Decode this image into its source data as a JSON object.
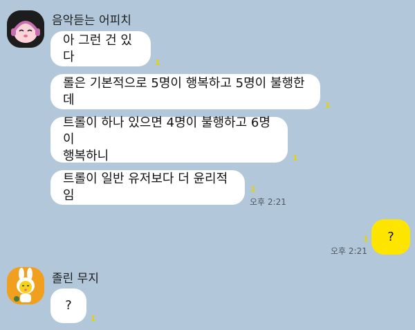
{
  "chat": {
    "sender1": {
      "name": "음악듣는 어피치",
      "avatar_icon": "apeach-headphones-icon",
      "messages": [
        {
          "text": "아 그런 건 있다",
          "unread": "1"
        },
        {
          "text": "롤은 기본적으로 5명이 행복하고 5명이 불행한데",
          "unread": "1"
        },
        {
          "text_line1": "트롤이 하나 있으면 4명이 불행하고 6명이",
          "text_line2": "행복하니",
          "unread": "1"
        },
        {
          "text": "트롤이 일반 유저보다 더 윤리적임",
          "unread": "1",
          "time": "오후 2:21"
        }
      ]
    },
    "me": {
      "messages": [
        {
          "text": "?",
          "unread": "1",
          "time": "오후 2:21"
        }
      ]
    },
    "sender2": {
      "name": "졸린 무지",
      "avatar_icon": "muzi-sleepy-icon",
      "messages": [
        {
          "text": "?",
          "unread": "1"
        }
      ]
    }
  },
  "colors": {
    "background": "#b2c7da",
    "my_bubble": "#fee500",
    "other_bubble": "#ffffff",
    "unread": "#e7d100"
  }
}
